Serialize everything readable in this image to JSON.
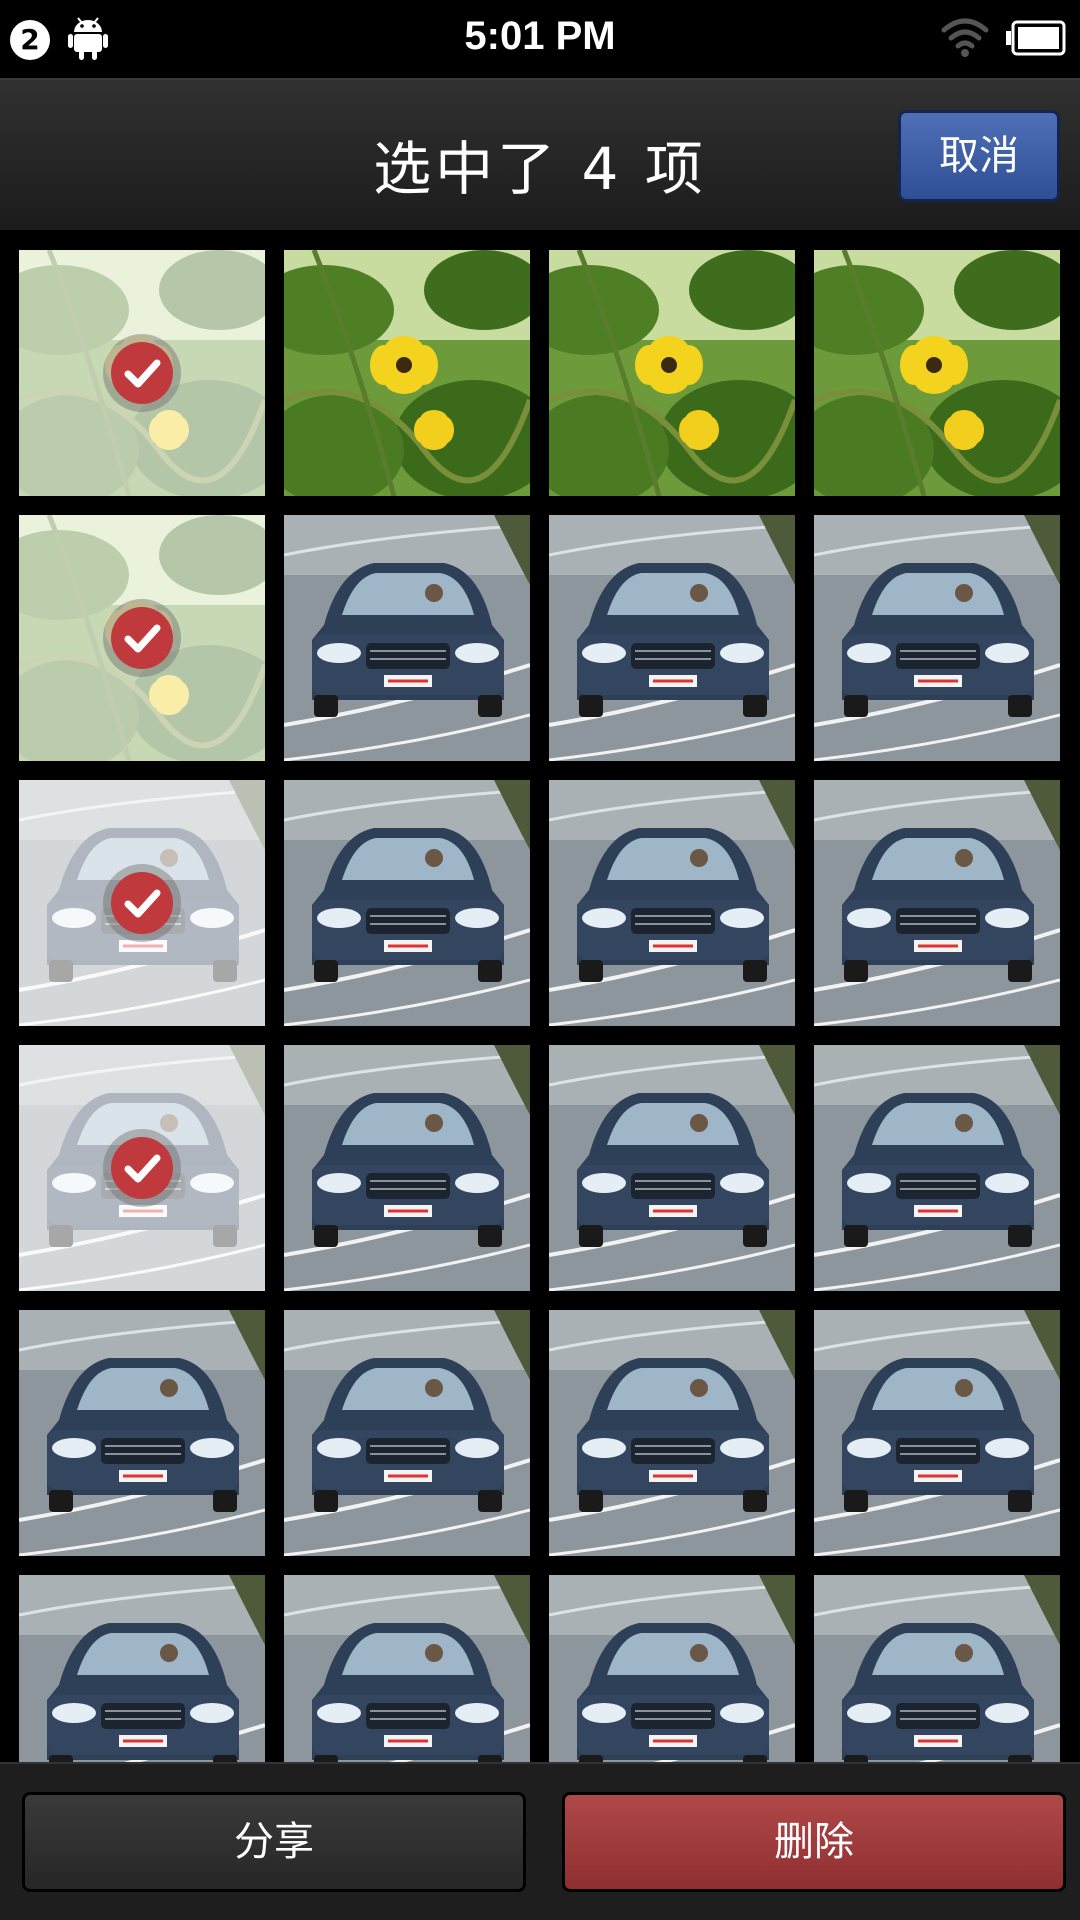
{
  "status_bar": {
    "notification_count": "2",
    "time": "5:01 PM",
    "icons": [
      "android-icon",
      "wifi-icon",
      "battery-icon"
    ]
  },
  "action_bar": {
    "title": "选中了 4 项",
    "cancel_label": "取消"
  },
  "grid": {
    "columns": 4,
    "thumbnails": [
      {
        "kind": "flower",
        "selected": true
      },
      {
        "kind": "flower",
        "selected": false
      },
      {
        "kind": "flower",
        "selected": false
      },
      {
        "kind": "flower",
        "selected": false
      },
      {
        "kind": "flower",
        "selected": true
      },
      {
        "kind": "car",
        "selected": false
      },
      {
        "kind": "car",
        "selected": false
      },
      {
        "kind": "car",
        "selected": false
      },
      {
        "kind": "car",
        "selected": true
      },
      {
        "kind": "car",
        "selected": false
      },
      {
        "kind": "car",
        "selected": false
      },
      {
        "kind": "car",
        "selected": false
      },
      {
        "kind": "car",
        "selected": true
      },
      {
        "kind": "car",
        "selected": false
      },
      {
        "kind": "car",
        "selected": false
      },
      {
        "kind": "car",
        "selected": false
      },
      {
        "kind": "car",
        "selected": false
      },
      {
        "kind": "car",
        "selected": false
      },
      {
        "kind": "car",
        "selected": false
      },
      {
        "kind": "car",
        "selected": false
      },
      {
        "kind": "car",
        "selected": false
      },
      {
        "kind": "car",
        "selected": false
      },
      {
        "kind": "car",
        "selected": false
      },
      {
        "kind": "car",
        "selected": false
      }
    ]
  },
  "bottom_bar": {
    "share_label": "分享",
    "delete_label": "删除"
  },
  "colors": {
    "cancel_button": "#3b5ba5",
    "delete_button": "#a03c3e",
    "check_badge": "#c0393c"
  }
}
